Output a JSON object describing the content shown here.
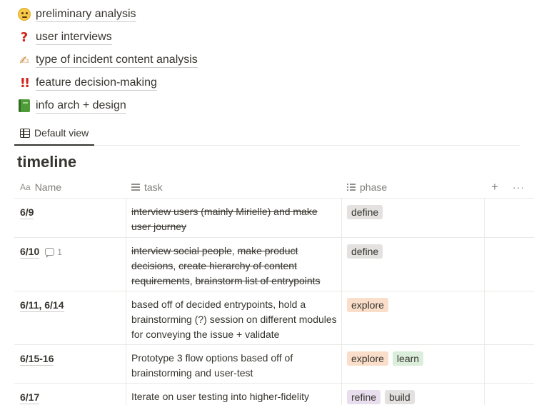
{
  "pages": [
    {
      "icon": "thinking-face-icon",
      "title": "preliminary analysis"
    },
    {
      "icon": "question-mark-icon",
      "title": "user interviews"
    },
    {
      "icon": "writing-hand-icon",
      "title": "type of incident content analysis"
    },
    {
      "icon": "double-exclamation-icon",
      "title": "feature decision-making"
    },
    {
      "icon": "green-book-icon",
      "title": "info arch + design"
    }
  ],
  "view": {
    "label": "Default view"
  },
  "database": {
    "title": "timeline"
  },
  "columns": {
    "name": "Name",
    "task": "task",
    "phase": "phase",
    "add": "+",
    "more": "···"
  },
  "rows": [
    {
      "name": "6/9",
      "comment_count": "",
      "task_segments": [
        {
          "text": "interview users (mainly Mirielle) and make user journey",
          "strike": true
        }
      ],
      "phases": [
        "define"
      ]
    },
    {
      "name": "6/10",
      "comment_count": "1",
      "task_segments": [
        {
          "text": "interview social people",
          "strike": true
        },
        {
          "text": ", ",
          "strike": false
        },
        {
          "text": "make product decisions",
          "strike": true
        },
        {
          "text": ", ",
          "strike": false
        },
        {
          "text": "create hierarchy of content requirements",
          "strike": true
        },
        {
          "text": ", ",
          "strike": false
        },
        {
          "text": "brainstorm list of entrypoints",
          "strike": true
        }
      ],
      "phases": [
        "define"
      ]
    },
    {
      "name": "6/11, 6/14",
      "comment_count": "",
      "task_segments": [
        {
          "text": "based off of decided entrypoints, hold a brainstorming (?) session on different modules for conveying the issue + validate",
          "strike": false
        }
      ],
      "phases": [
        "explore"
      ]
    },
    {
      "name": "6/15-16",
      "comment_count": "",
      "task_segments": [
        {
          "text": "Prototype 3 flow options based off of brainstorming and user-test",
          "strike": false
        }
      ],
      "phases": [
        "explore",
        "learn"
      ]
    },
    {
      "name": "6/17",
      "comment_count": "",
      "task_segments": [
        {
          "text": "Iterate on user testing into higher-fidelity",
          "strike": false
        }
      ],
      "phases": [
        "refine",
        "build"
      ]
    }
  ],
  "colors": {
    "define": "#e3e2e0",
    "explore": "#fadec9",
    "learn": "#dbeddb",
    "refine": "#e8deee",
    "build": "#e3e2e0",
    "text": "#37352f"
  }
}
